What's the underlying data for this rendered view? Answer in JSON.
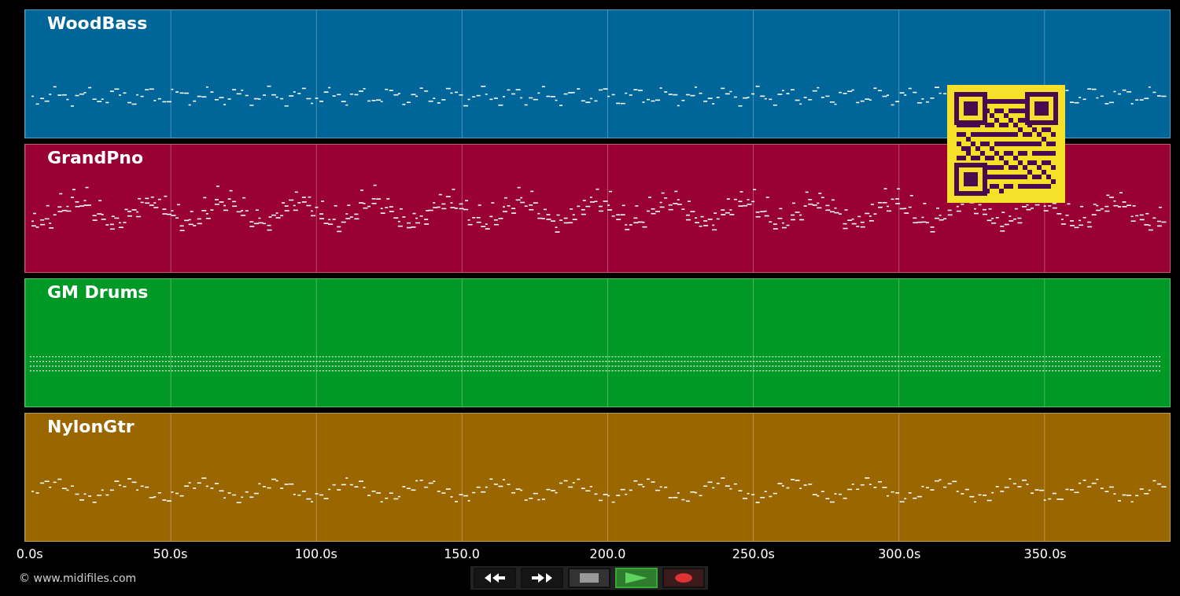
{
  "tracks": [
    {
      "name": "WoodBass",
      "color": "#006699"
    },
    {
      "name": "GrandPno",
      "color": "#990033"
    },
    {
      "name": "GM Drums",
      "color": "#009926"
    },
    {
      "name": "NylonGtr",
      "color": "#996600"
    }
  ],
  "axis": {
    "ticks": [
      "0.0s",
      "50.0s",
      "100.0s",
      "150.0",
      "200.0",
      "250.0s",
      "300.0s",
      "350.0s"
    ]
  },
  "copyright": "© www.midifiles.com",
  "transport": [
    {
      "kind": "rewind",
      "selected": false
    },
    {
      "kind": "forward",
      "selected": false
    },
    {
      "kind": "stop",
      "selected": false
    },
    {
      "kind": "play",
      "selected": true
    },
    {
      "kind": "record",
      "selected": false
    }
  ]
}
